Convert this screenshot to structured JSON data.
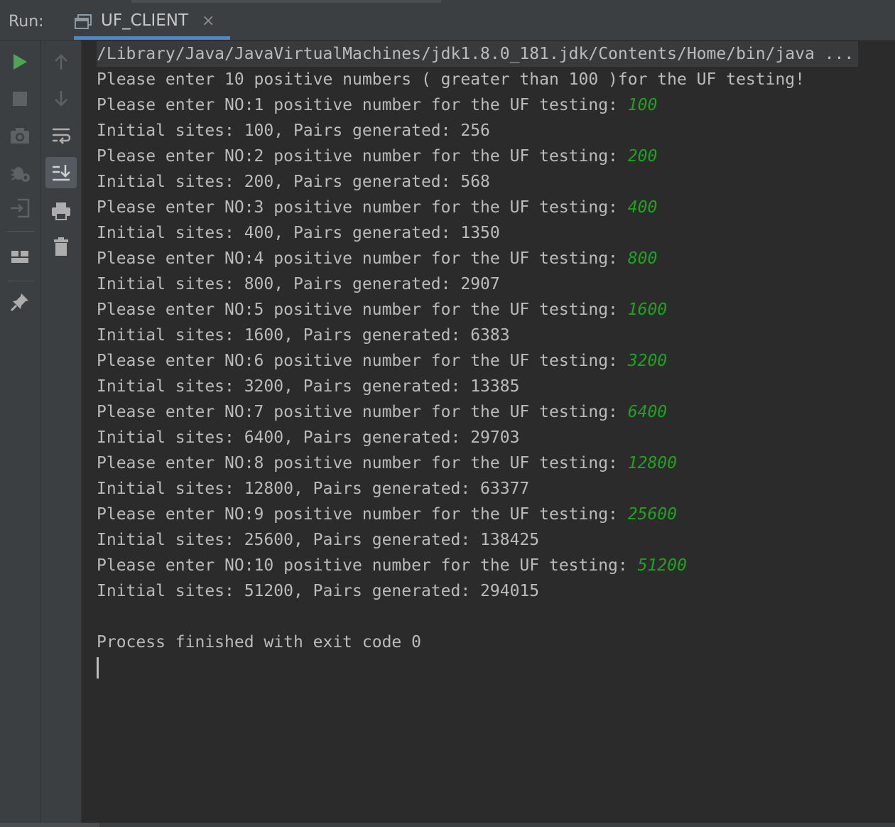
{
  "run_bar": {
    "label": "Run:",
    "tab_title": "UF_CLIENT",
    "close_glyph": "×"
  },
  "toolbar_left": [
    {
      "name": "rerun-icon",
      "color": "#4fa552"
    },
    {
      "name": "stop-icon",
      "color": "#6e6e6e"
    },
    {
      "name": "camera-icon",
      "color": "#6e6e6e"
    },
    {
      "name": "debug-settings-icon",
      "color": "#6e6e6e"
    },
    {
      "name": "import-icon",
      "color": "#6e6e6e"
    },
    {
      "name": "layout-icon",
      "color": "#adadad"
    },
    {
      "name": "pin-icon",
      "color": "#adadad"
    }
  ],
  "toolbar_right": [
    {
      "name": "up-arrow-icon"
    },
    {
      "name": "down-arrow-icon"
    },
    {
      "name": "soft-wrap-icon"
    },
    {
      "name": "scroll-to-end-icon",
      "active": true
    },
    {
      "name": "print-icon"
    },
    {
      "name": "trash-icon"
    }
  ],
  "console": {
    "command": "/Library/Java/JavaVirtualMachines/jdk1.8.0_181.jdk/Contents/Home/bin/java ...",
    "intro": "Please enter 10 positive numbers ( greater than 100 )for the UF testing!",
    "entries": [
      {
        "prompt": "Please enter NO:1 positive number for the UF testing: ",
        "input": "100",
        "result": "Initial sites: 100, Pairs generated: 256"
      },
      {
        "prompt": "Please enter NO:2 positive number for the UF testing: ",
        "input": "200",
        "result": "Initial sites: 200, Pairs generated: 568"
      },
      {
        "prompt": "Please enter NO:3 positive number for the UF testing: ",
        "input": "400",
        "result": "Initial sites: 400, Pairs generated: 1350"
      },
      {
        "prompt": "Please enter NO:4 positive number for the UF testing: ",
        "input": "800",
        "result": "Initial sites: 800, Pairs generated: 2907"
      },
      {
        "prompt": "Please enter NO:5 positive number for the UF testing: ",
        "input": "1600",
        "result": "Initial sites: 1600, Pairs generated: 6383"
      },
      {
        "prompt": "Please enter NO:6 positive number for the UF testing: ",
        "input": "3200",
        "result": "Initial sites: 3200, Pairs generated: 13385"
      },
      {
        "prompt": "Please enter NO:7 positive number for the UF testing: ",
        "input": "6400",
        "result": "Initial sites: 6400, Pairs generated: 29703"
      },
      {
        "prompt": "Please enter NO:8 positive number for the UF testing: ",
        "input": "12800",
        "result": "Initial sites: 12800, Pairs generated: 63377"
      },
      {
        "prompt": "Please enter NO:9 positive number for the UF testing: ",
        "input": "25600",
        "result": "Initial sites: 25600, Pairs generated: 138425"
      },
      {
        "prompt": "Please enter NO:10 positive number for the UF testing: ",
        "input": "51200",
        "result": "Initial sites: 51200, Pairs generated: 294015"
      }
    ],
    "finish": "Process finished with exit code 0"
  },
  "colors": {
    "input_green": "#1da41d",
    "text": "#bbbbbb",
    "tab_accent": "#4a88c7"
  }
}
